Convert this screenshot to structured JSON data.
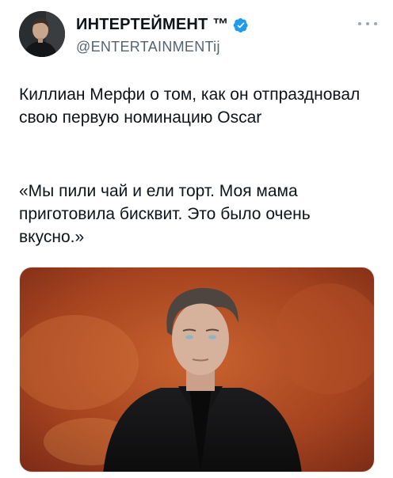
{
  "author": {
    "display_name": "ИНТЕРТЕЙМЕНТ ™",
    "handle": "@ENTERTAINMENTij",
    "verified_badge": "verified-badge-icon",
    "verified_color": "#1d9bf0"
  },
  "tweet": {
    "paragraph_1": "Киллиан Мерфи о том, как он отпраздновал свою первую номинацию Oscar",
    "paragraph_2": "«Мы пили чай и ели торт. Моя мама приготовила бисквит. Это было очень вкусно.»"
  },
  "colors": {
    "text_primary": "#0f1419",
    "text_secondary": "#536471",
    "media_background": "#b84a26"
  }
}
